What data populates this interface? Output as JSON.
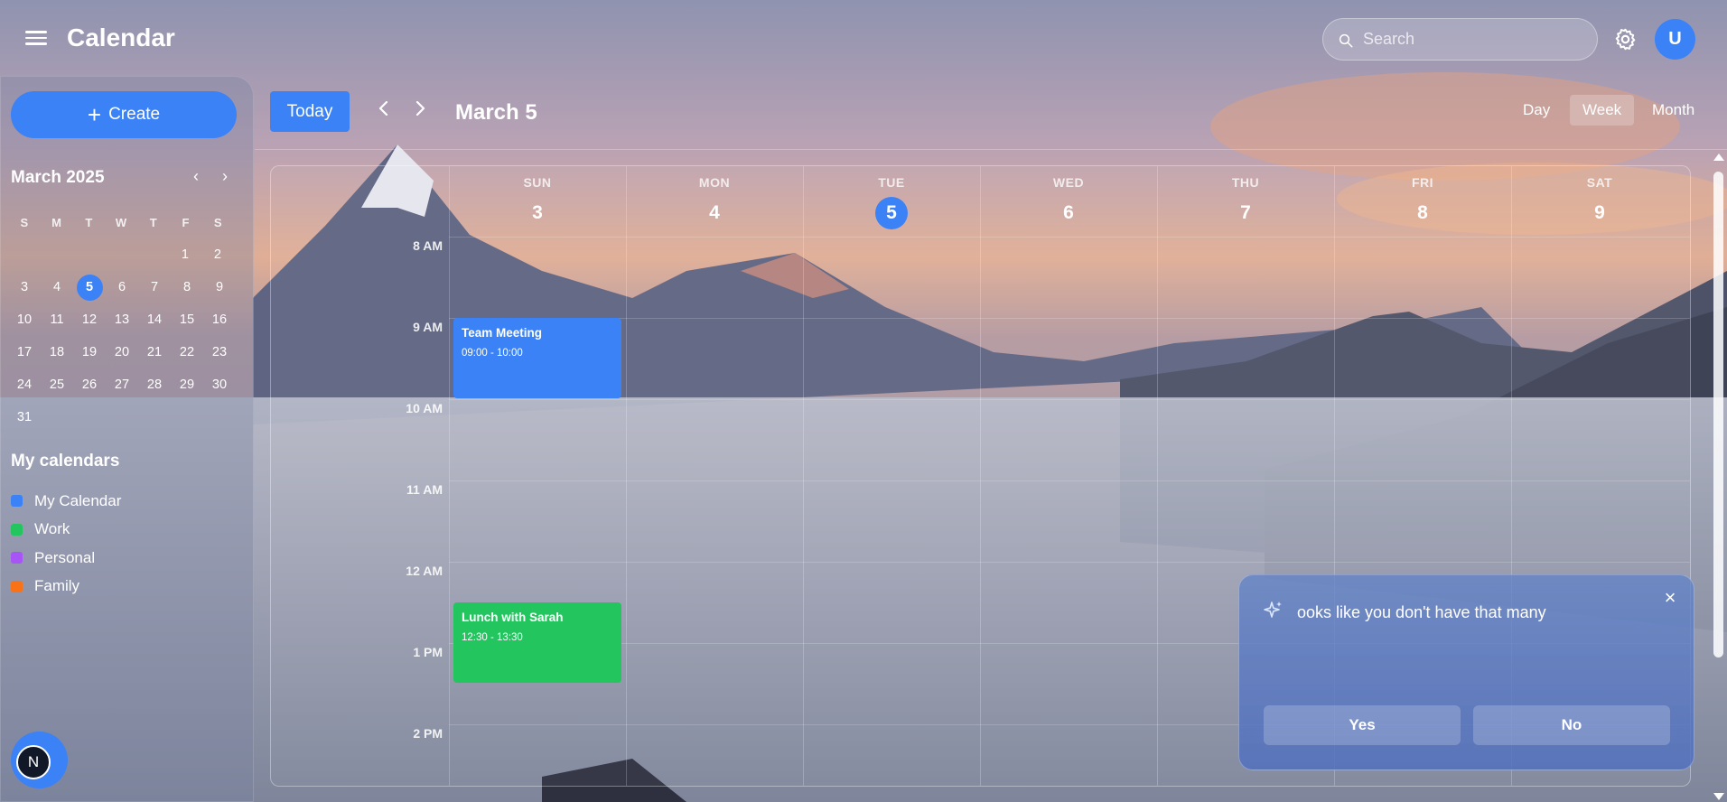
{
  "header": {
    "title": "Calendar",
    "search_placeholder": "Search",
    "avatar_initial": "U"
  },
  "sidebar": {
    "create_label": "Create",
    "mini_month": "March 2025",
    "weekday_letters": [
      "S",
      "M",
      "T",
      "W",
      "T",
      "F",
      "S"
    ],
    "weeks": [
      [
        "",
        "",
        "",
        "",
        "",
        "1",
        "2"
      ],
      [
        "3",
        "4",
        "5",
        "6",
        "7",
        "8",
        "9"
      ],
      [
        "10",
        "11",
        "12",
        "13",
        "14",
        "15",
        "16"
      ],
      [
        "17",
        "18",
        "19",
        "20",
        "21",
        "22",
        "23"
      ],
      [
        "24",
        "25",
        "26",
        "27",
        "28",
        "29",
        "30"
      ],
      [
        "31",
        "",
        "",
        "",
        "",
        "",
        ""
      ]
    ],
    "selected_day": "5",
    "my_calendars_title": "My calendars",
    "calendars": [
      {
        "label": "My Calendar",
        "color": "#3b82f6"
      },
      {
        "label": "Work",
        "color": "#22c55e"
      },
      {
        "label": "Personal",
        "color": "#a855f7"
      },
      {
        "label": "Family",
        "color": "#f97316"
      }
    ],
    "bottom_badge": "N"
  },
  "toolbar": {
    "today_label": "Today",
    "date_title": "March 5",
    "views": [
      "Day",
      "Week",
      "Month"
    ],
    "active_view": "Week"
  },
  "week": {
    "days": [
      {
        "dow": "SUN",
        "num": "3"
      },
      {
        "dow": "MON",
        "num": "4"
      },
      {
        "dow": "TUE",
        "num": "5",
        "today": true
      },
      {
        "dow": "WED",
        "num": "6"
      },
      {
        "dow": "THU",
        "num": "7"
      },
      {
        "dow": "FRI",
        "num": "8"
      },
      {
        "dow": "SAT",
        "num": "9"
      }
    ],
    "times": [
      "8 AM",
      "9 AM",
      "10 AM",
      "11 AM",
      "12 AM",
      "1 PM",
      "2 PM"
    ]
  },
  "events": [
    {
      "title": "Team Meeting",
      "time": "09:00 - 10:00",
      "color": "#3b82f6"
    },
    {
      "title": "Lunch with Sarah",
      "time": "12:30 - 13:30",
      "color": "#22c55e"
    }
  ],
  "popup": {
    "message": "ooks like you don't have that many",
    "yes_label": "Yes",
    "no_label": "No",
    "close_symbol": "×"
  }
}
